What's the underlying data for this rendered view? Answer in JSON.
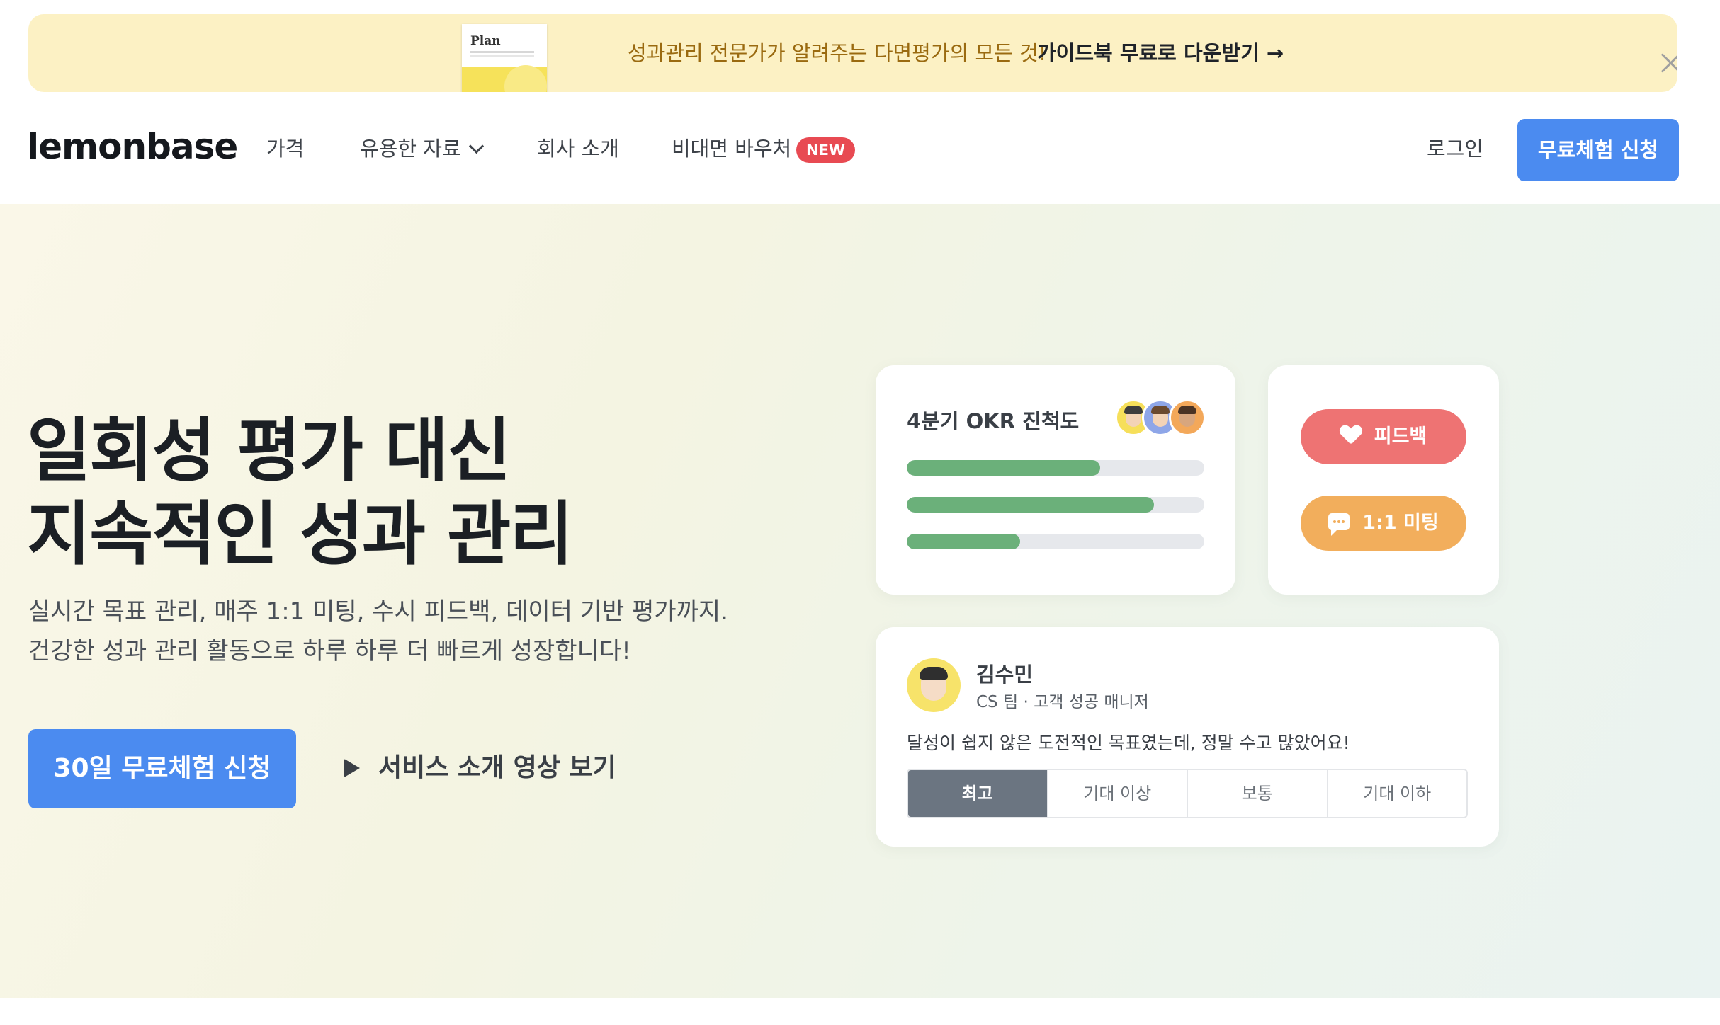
{
  "banner": {
    "book_title": "Plan",
    "message": "성과관리 전문가가 알려주는 다면평가의 모든 것!",
    "cta": "가이드북 무료로 다운받기 →",
    "close_icon": "close-icon"
  },
  "nav": {
    "logo": "lemonbase",
    "items": [
      {
        "label": "가격"
      },
      {
        "label": "유용한 자료"
      },
      {
        "label": "회사 소개"
      },
      {
        "label": "비대면 바우처"
      }
    ],
    "new_badge": "NEW",
    "login": "로그인",
    "trial_button": "무료체험 신청"
  },
  "hero": {
    "title_line1": "일회성 평가 대신",
    "title_line2": "지속적인 성과 관리",
    "subtitle_line1": "실시간 목표 관리, 매주 1:1 미팅, 수시 피드백, 데이터 기반 평가까지.",
    "subtitle_line2": "건강한 성과 관리 활동으로 하루 하루 더 빠르게 성장합니다!",
    "cta_button": "30일 무료체험 신청",
    "video_link": "서비스 소개 영상 보기"
  },
  "okr_card": {
    "title": "4분기 OKR 진척도",
    "progress": [
      0.65,
      0.83,
      0.38
    ],
    "colors": {
      "fill": "#6bb07a",
      "track": "#e6e8ec"
    }
  },
  "actions": {
    "feedback": "피드백",
    "meeting": "1:1 미팅"
  },
  "review": {
    "name": "김수민",
    "role": "CS 팀 · 고객 성공 매니저",
    "text": "달성이 쉽지 않은 도전적인 목표였는데, 정말 수고 많았어요!",
    "ratings": [
      "최고",
      "기대 이상",
      "보통",
      "기대 이하"
    ],
    "selected": "최고"
  },
  "colors": {
    "primary": "#4b8bf0",
    "banner_bg": "#fcf1c4",
    "new_badge": "#e84a52",
    "feedback": "#ee7373",
    "meeting": "#f2ae5c"
  }
}
